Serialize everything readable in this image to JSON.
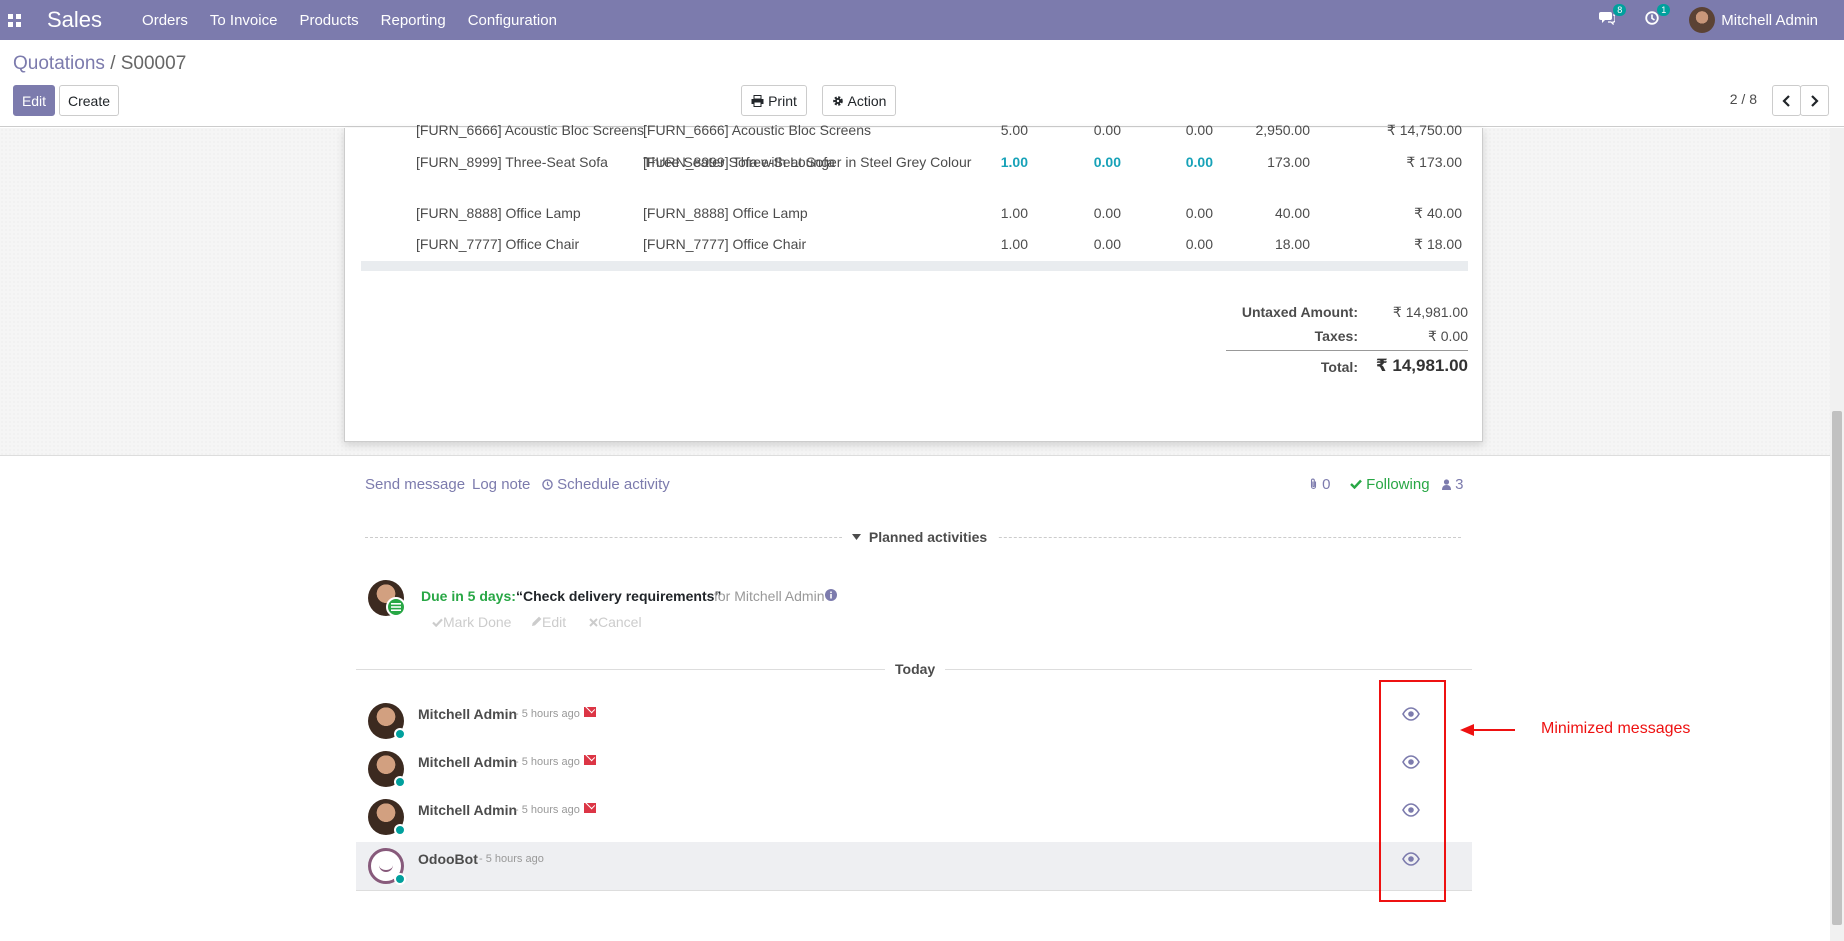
{
  "navbar": {
    "app_name": "Sales",
    "menu": [
      "Orders",
      "To Invoice",
      "Products",
      "Reporting",
      "Configuration"
    ],
    "messages_badge": "8",
    "activities_badge": "1",
    "user_name": "Mitchell Admin",
    "color": "#7c7bad"
  },
  "control_panel": {
    "breadcrumb_parent": "Quotations",
    "breadcrumb_sep": "/",
    "breadcrumb_current": "S00007",
    "edit_label": "Edit",
    "create_label": "Create",
    "print_label": "Print",
    "action_label": "Action",
    "pager": "2 / 8"
  },
  "order_lines": [
    {
      "product": "[FURN_6666] Acoustic Bloc Screens",
      "description": "[FURN_6666] Acoustic Bloc Screens",
      "description2": "",
      "quantity": "5.00",
      "delivered": "0.00",
      "invoiced": "0.00",
      "unit_price": "2,950.00",
      "subtotal": "₹ 14,750.00"
    },
    {
      "product": "[FURN_8999] Three-Seat Sofa",
      "description": "[FURN_8999] Three-Seat Sofa",
      "description2": "Three Seater Sofa with Lounger in Steel Grey Colour",
      "quantity": "1.00",
      "delivered": "0.00",
      "invoiced": "0.00",
      "unit_price": "173.00",
      "subtotal": "₹ 173.00"
    },
    {
      "product": "[FURN_8888] Office Lamp",
      "description": "[FURN_8888] Office Lamp",
      "description2": "",
      "quantity": "1.00",
      "delivered": "0.00",
      "invoiced": "0.00",
      "unit_price": "40.00",
      "subtotal": "₹ 40.00"
    },
    {
      "product": "[FURN_7777] Office Chair",
      "description": "[FURN_7777] Office Chair",
      "description2": "",
      "quantity": "1.00",
      "delivered": "0.00",
      "invoiced": "0.00",
      "unit_price": "18.00",
      "subtotal": "₹ 18.00"
    }
  ],
  "totals": {
    "untaxed_label": "Untaxed Amount:",
    "untaxed_value": "₹ 14,981.00",
    "taxes_label": "Taxes:",
    "taxes_value": "₹ 0.00",
    "total_label": "Total:",
    "total_value": "₹ 14,981.00"
  },
  "chatter": {
    "send_message": "Send message",
    "log_note": "Log note",
    "schedule_activity": "Schedule activity",
    "attachments_count": "0",
    "following_label": "Following",
    "followers_count": "3",
    "planned_activities_label": "Planned activities",
    "activity": {
      "due": "Due in 5 days:",
      "summary": "“Check delivery requirements”",
      "for_text": "for Mitchell Admin",
      "mark_done": "Mark Done",
      "edit": "Edit",
      "cancel": "Cancel"
    },
    "today_label": "Today",
    "messages": [
      {
        "author": "Mitchell Admin",
        "date": "- 5 hours ago",
        "email": true
      },
      {
        "author": "Mitchell Admin",
        "date": "- 5 hours ago",
        "email": true
      },
      {
        "author": "Mitchell Admin",
        "date": "- 5 hours ago",
        "email": true
      },
      {
        "author": "OdooBot",
        "date": "- 5 hours ago",
        "email": false
      }
    ]
  },
  "annotation": {
    "text": "Minimized messages",
    "color": "#ee1111"
  }
}
